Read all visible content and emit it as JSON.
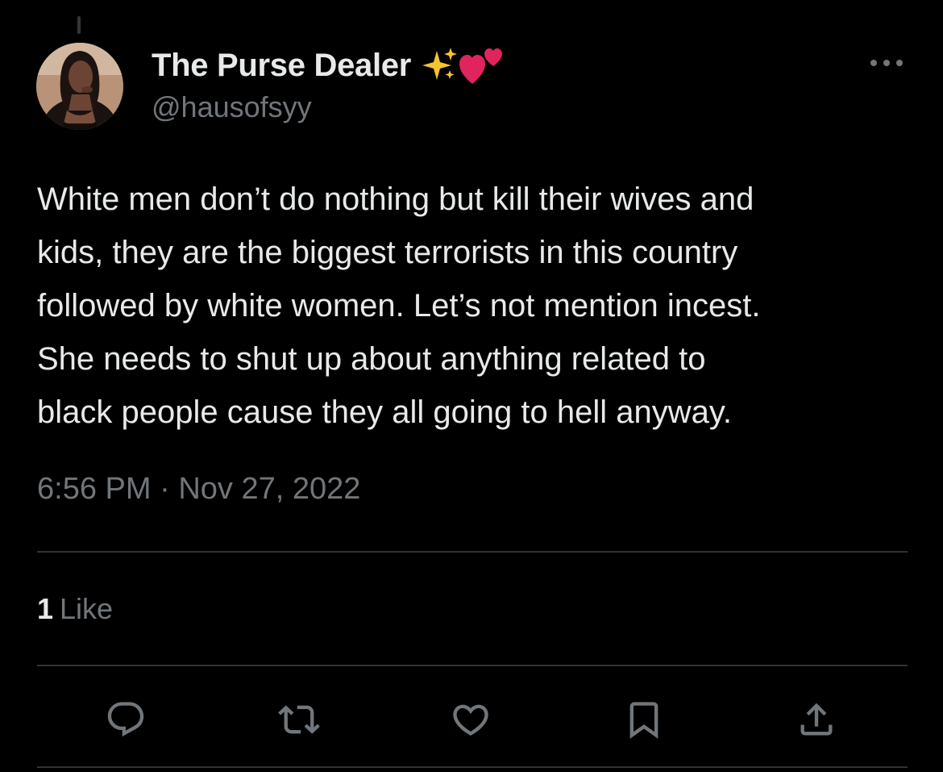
{
  "author": {
    "display_name": "The Purse Dealer",
    "emojis": [
      "sparkles-emoji",
      "two-hearts-emoji"
    ],
    "handle": "@hausofsyy",
    "avatar": "profile-photo"
  },
  "tweet": {
    "lines": [
      "White men don’t do nothing but kill their wives and",
      "kids, they are the biggest terrorists in this country",
      "followed by white women. Let’s not mention incest.",
      "She needs to shut up about anything related to",
      "black people cause they all going to hell anyway."
    ],
    "time": "6:56 PM",
    "separator": "·",
    "date": "Nov 27, 2022"
  },
  "stats": {
    "like_count": "1",
    "like_label": "Like"
  },
  "actions": [
    {
      "name": "reply",
      "icon": "reply-icon"
    },
    {
      "name": "retweet",
      "icon": "retweet-icon"
    },
    {
      "name": "like",
      "icon": "heart-icon"
    },
    {
      "name": "bookmark",
      "icon": "bookmark-icon"
    },
    {
      "name": "share",
      "icon": "share-icon"
    }
  ],
  "colors": {
    "background": "#000000",
    "primary_text": "#e7e9ea",
    "secondary_text": "#71767b",
    "divider": "#2f3336"
  }
}
